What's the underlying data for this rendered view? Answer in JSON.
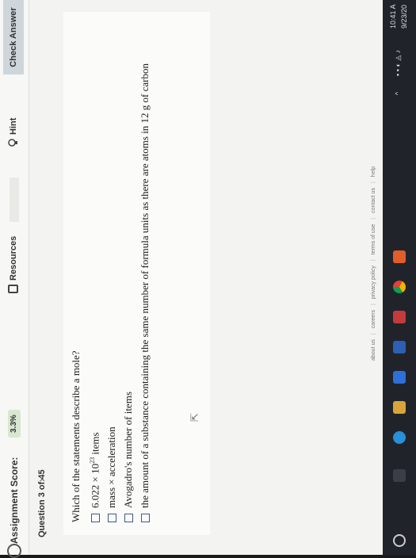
{
  "header": {
    "score_label": "Assignment Score:",
    "score_value": "3.3%",
    "resources_label": "Resources",
    "hint_label": "Hint",
    "check_answer_label": "Check Answer"
  },
  "question": {
    "counter": "Question 3 of 45",
    "next_glyph": "›",
    "prompt": "Which of the statements describe a mole?",
    "options": [
      {
        "text": "6.022 × 10",
        "sup": "23",
        "suffix": " items"
      },
      {
        "text": "mass × acceleration"
      },
      {
        "text": "Avogadro's number of items"
      },
      {
        "text": "the amount of a substance containing the same number of formula units as there are atoms in 12 g of carbon"
      }
    ]
  },
  "footer": {
    "links": [
      "about us",
      "careers",
      "privacy policy",
      "terms of use",
      "contact us",
      "help"
    ]
  },
  "taskbar": {
    "time": "10:41 A",
    "date": "9/23/20"
  }
}
